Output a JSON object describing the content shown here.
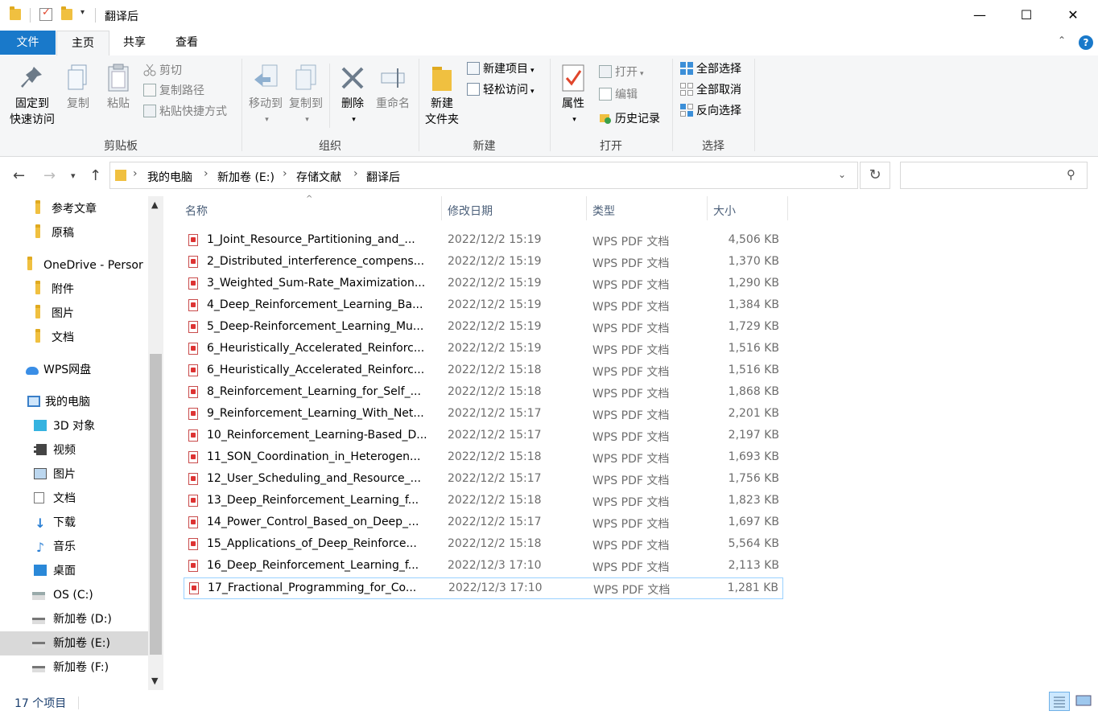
{
  "window": {
    "title": "翻译后",
    "minimize_glyph": "—",
    "maximize_glyph": "☐",
    "close_glyph": "✕"
  },
  "ribbon_tabs": {
    "file": "文件",
    "home": "主页",
    "share": "共享",
    "view": "查看"
  },
  "ribbon": {
    "clipboard": {
      "label": "剪贴板",
      "pin_line1": "固定到",
      "pin_line2": "快速访问",
      "copy": "复制",
      "paste": "粘贴",
      "cut": "剪切",
      "copy_path": "复制路径",
      "paste_shortcut": "粘贴快捷方式"
    },
    "organize": {
      "label": "组织",
      "move_to": "移动到",
      "copy_to": "复制到",
      "delete": "删除",
      "rename": "重命名"
    },
    "new": {
      "label": "新建",
      "new_folder_line1": "新建",
      "new_folder_line2": "文件夹",
      "new_item": "新建项目",
      "easy_access": "轻松访问"
    },
    "open": {
      "label": "打开",
      "properties": "属性",
      "open": "打开",
      "edit": "编辑",
      "history": "历史记录"
    },
    "select": {
      "label": "选择",
      "select_all": "全部选择",
      "select_none": "全部取消",
      "invert": "反向选择"
    }
  },
  "breadcrumb": [
    "我的电脑",
    "新加卷 (E:)",
    "存储文献",
    "翻译后"
  ],
  "nav_pane": [
    {
      "label": "参考文章",
      "icon": "folder-icon"
    },
    {
      "label": "原稿",
      "icon": "folder-icon"
    },
    {
      "label": "OneDrive - Persor",
      "icon": "folder-icon"
    },
    {
      "label": "附件",
      "icon": "folder-icon"
    },
    {
      "label": "图片",
      "icon": "folder-icon"
    },
    {
      "label": "文档",
      "icon": "folder-icon"
    },
    {
      "label": "WPS网盘",
      "icon": "cloud-icon"
    },
    {
      "label": "我的电脑",
      "icon": "computer-icon"
    },
    {
      "label": "3D 对象",
      "icon": "cube-icon"
    },
    {
      "label": "视频",
      "icon": "video-icon"
    },
    {
      "label": "图片",
      "icon": "picture-icon"
    },
    {
      "label": "文档",
      "icon": "document-icon"
    },
    {
      "label": "下载",
      "icon": "download-icon"
    },
    {
      "label": "音乐",
      "icon": "music-icon"
    },
    {
      "label": "桌面",
      "icon": "desktop-icon"
    },
    {
      "label": "OS (C:)",
      "icon": "drive-icon"
    },
    {
      "label": "新加卷 (D:)",
      "icon": "drive-icon"
    },
    {
      "label": "新加卷 (E:)",
      "icon": "drive-icon"
    },
    {
      "label": "新加卷 (F:)",
      "icon": "drive-icon"
    }
  ],
  "columns": {
    "name": "名称",
    "date": "修改日期",
    "type": "类型",
    "size": "大小"
  },
  "files": [
    {
      "name": "1_Joint_Resource_Partitioning_and_...",
      "date": "2022/12/2 15:19",
      "type": "WPS PDF 文档",
      "size": "4,506 KB"
    },
    {
      "name": "2_Distributed_interference_compens...",
      "date": "2022/12/2 15:19",
      "type": "WPS PDF 文档",
      "size": "1,370 KB"
    },
    {
      "name": "3_Weighted_Sum-Rate_Maximization...",
      "date": "2022/12/2 15:19",
      "type": "WPS PDF 文档",
      "size": "1,290 KB"
    },
    {
      "name": "4_Deep_Reinforcement_Learning_Ba...",
      "date": "2022/12/2 15:19",
      "type": "WPS PDF 文档",
      "size": "1,384 KB"
    },
    {
      "name": "5_Deep-Reinforcement_Learning_Mu...",
      "date": "2022/12/2 15:19",
      "type": "WPS PDF 文档",
      "size": "1,729 KB"
    },
    {
      "name": "6_Heuristically_Accelerated_Reinforc...",
      "date": "2022/12/2 15:19",
      "type": "WPS PDF 文档",
      "size": "1,516 KB"
    },
    {
      "name": "6_Heuristically_Accelerated_Reinforc...",
      "date": "2022/12/2 15:18",
      "type": "WPS PDF 文档",
      "size": "1,516 KB"
    },
    {
      "name": "8_Reinforcement_Learning_for_Self_...",
      "date": "2022/12/2 15:18",
      "type": "WPS PDF 文档",
      "size": "1,868 KB"
    },
    {
      "name": "9_Reinforcement_Learning_With_Net...",
      "date": "2022/12/2 15:17",
      "type": "WPS PDF 文档",
      "size": "2,201 KB"
    },
    {
      "name": "10_Reinforcement_Learning-Based_D...",
      "date": "2022/12/2 15:17",
      "type": "WPS PDF 文档",
      "size": "2,197 KB"
    },
    {
      "name": "11_SON_Coordination_in_Heterogen...",
      "date": "2022/12/2 15:18",
      "type": "WPS PDF 文档",
      "size": "1,693 KB"
    },
    {
      "name": "12_User_Scheduling_and_Resource_...",
      "date": "2022/12/2 15:17",
      "type": "WPS PDF 文档",
      "size": "1,756 KB"
    },
    {
      "name": "13_Deep_Reinforcement_Learning_f...",
      "date": "2022/12/2 15:18",
      "type": "WPS PDF 文档",
      "size": "1,823 KB"
    },
    {
      "name": "14_Power_Control_Based_on_Deep_...",
      "date": "2022/12/2 15:17",
      "type": "WPS PDF 文档",
      "size": "1,697 KB"
    },
    {
      "name": "15_Applications_of_Deep_Reinforce...",
      "date": "2022/12/2 15:18",
      "type": "WPS PDF 文档",
      "size": "5,564 KB"
    },
    {
      "name": "16_Deep_Reinforcement_Learning_f...",
      "date": "2022/12/3 17:10",
      "type": "WPS PDF 文档",
      "size": "2,113 KB"
    },
    {
      "name": "17_Fractional_Programming_for_Co...",
      "date": "2022/12/3 17:10",
      "type": "WPS PDF 文档",
      "size": "1,281 KB"
    }
  ],
  "status": {
    "count": "17 个项目"
  },
  "colors": {
    "accent": "#1979ca",
    "folder": "#f0c040",
    "pdf_red": "#d33333",
    "selection_border": "#99d1ff"
  }
}
